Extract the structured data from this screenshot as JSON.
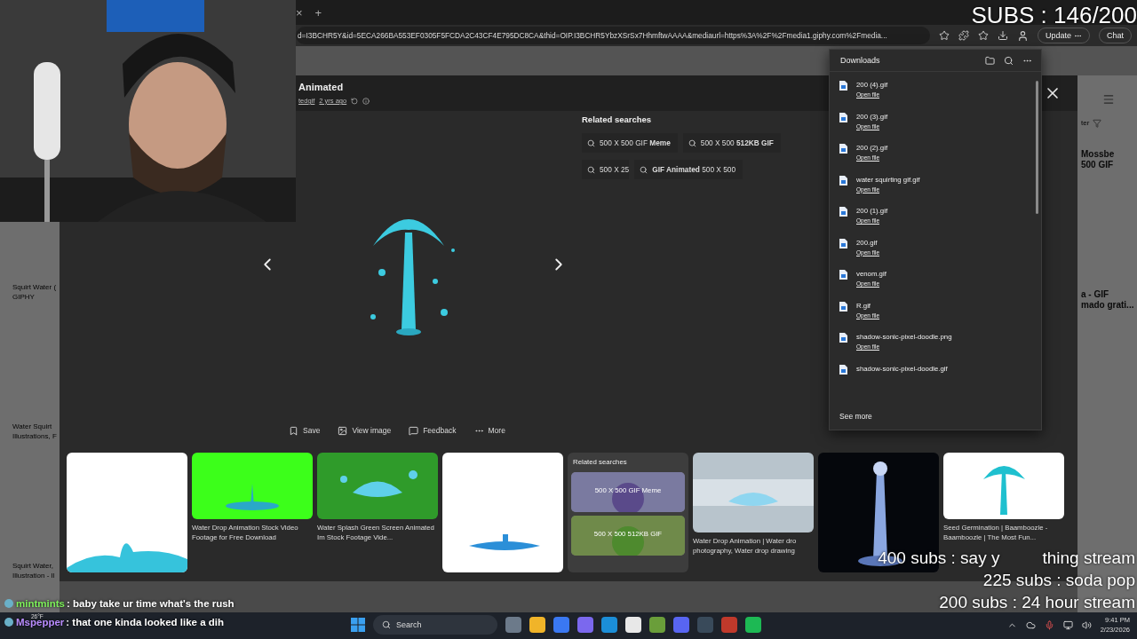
{
  "browser": {
    "tab_close": "×",
    "new_tab": "+",
    "url": "d=I3BCHR5Y&id=5ECA266BA553EF0305F5FCDA2C43CF4E795DC8CA&thid=OIP.I3BCHR5YbzXSrSx7HhmftwAAAA&mediaurl=https%3A%2F%2Fmedia1.giphy.com%2Fmedia...",
    "update": "Update",
    "chat": "Chat"
  },
  "background": {
    "left": [
      {
        "lines": [
          "Squirt Water (",
          "GIPHY"
        ]
      },
      {
        "lines": [
          "Water Squirt",
          "Illustrations, F"
        ]
      },
      {
        "lines": [
          "Squirt Water,",
          "Illustration - Il"
        ]
      }
    ],
    "filter": "ter",
    "right": [
      {
        "lines": [
          "Mossbe",
          "500 GIF"
        ]
      },
      {
        "lines": [
          "a - GIF",
          "mado grati..."
        ]
      }
    ]
  },
  "modal": {
    "title": "Animated",
    "source": "tedgif",
    "age": "2 yrs ago",
    "related_title": "Related searches",
    "related": [
      "500 X 500 GIF **Meme**",
      "500 X 500 **512KB GIF**",
      "500 X 25",
      "**GIF Animated** 500 X 500"
    ],
    "actions": [
      {
        "kind": "save",
        "label": "Save"
      },
      {
        "kind": "view",
        "label": "View image"
      },
      {
        "kind": "feedback",
        "label": "Feedback"
      },
      {
        "kind": "more",
        "label": "More"
      }
    ],
    "thumbs": [
      {
        "kind": "picture"
      },
      {
        "kind": "picture",
        "caption": "Water Drop Animation Stock Video Footage for Free Download"
      },
      {
        "kind": "picture",
        "caption": "Water Splash Green Screen Animated Im Stock Footage Vide..."
      },
      {
        "kind": "picture"
      },
      {
        "kind": "related",
        "title": "Related searches",
        "tiles": [
          "500 X 500 GIF Meme",
          "500 X 500 512KB GIF"
        ]
      },
      {
        "kind": "picture",
        "caption": "Water Drop Animation | Water dro photography, Water drop drawing"
      },
      {
        "kind": "picture"
      },
      {
        "kind": "picture",
        "caption": "Seed Germination | Baamboozle - Baamboozle | The Most Fun..."
      }
    ]
  },
  "downloads": {
    "title": "Downloads",
    "items": [
      {
        "name": "200 (4).gif",
        "action": "Open file"
      },
      {
        "name": "200 (3).gif",
        "action": "Open file"
      },
      {
        "name": "200 (2).gif",
        "action": "Open file"
      },
      {
        "name": "water squirting gif.gif",
        "action": "Open file"
      },
      {
        "name": "200 (1).gif",
        "action": "Open file"
      },
      {
        "name": "200.gif",
        "action": "Open file"
      },
      {
        "name": "venom.gif",
        "action": "Open file"
      },
      {
        "name": "R.gif",
        "action": "Open file"
      },
      {
        "name": "shadow-sonic-pixel-doodle.png",
        "action": "Open file"
      },
      {
        "name": "shadow-sonic-pixel-doodle.gif"
      }
    ],
    "see_more": "See more"
  },
  "overlay": {
    "subs": "SUBS : 146/200",
    "goals": [
      {
        "parts": [
          "400 subs :  say y",
          "thing stream"
        ]
      },
      {
        "parts": [
          "225 subs : soda pop"
        ]
      },
      {
        "parts": [
          "200 subs : 24 hour stream"
        ]
      }
    ]
  },
  "chat": [
    {
      "user": "mintmints",
      "color": "#7df05a",
      "message": ": baby take ur time what's the rush"
    },
    {
      "user": "Mspepper",
      "color": "#b98cff",
      "message": ": that one kinda looked like a dih"
    }
  ],
  "taskbar": {
    "weather": "26°F",
    "search": "Search",
    "time": "9:41 PM",
    "date": "2/23/2026"
  }
}
